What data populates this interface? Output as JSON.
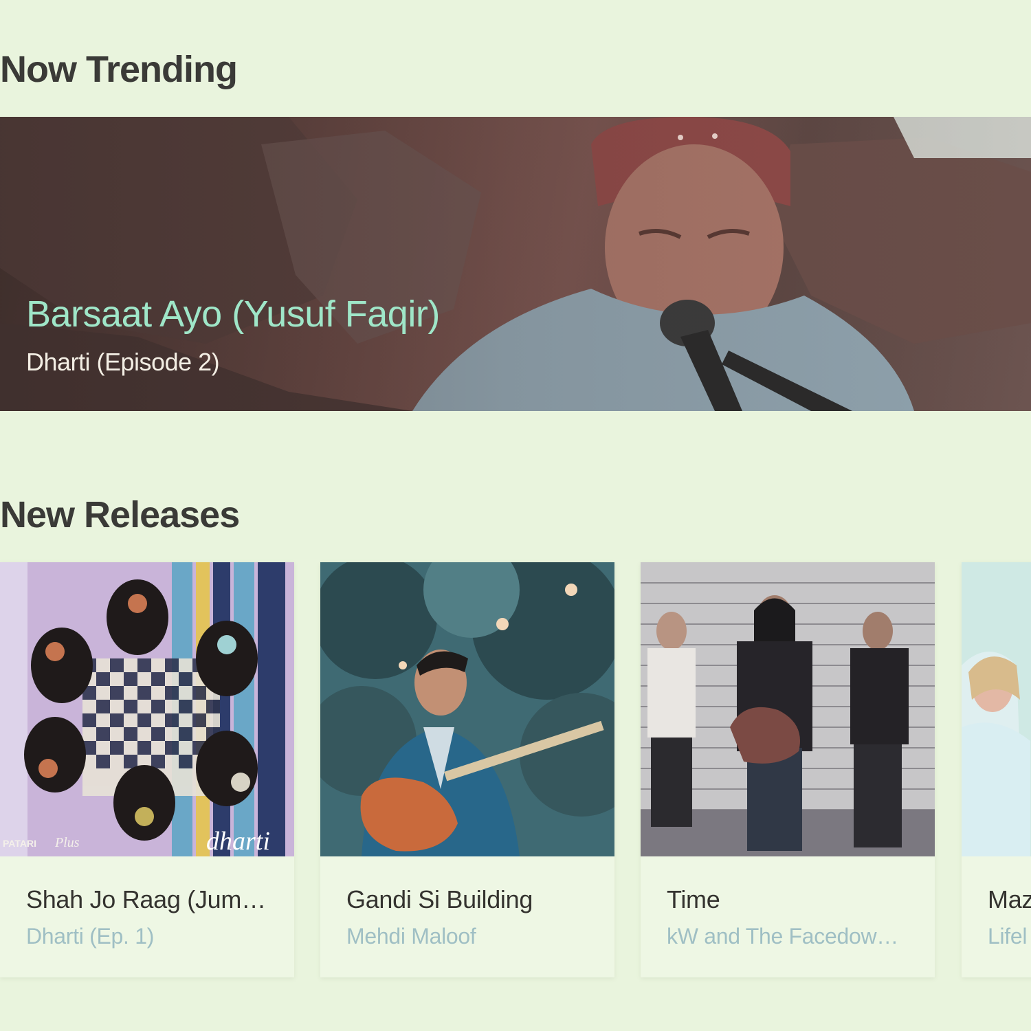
{
  "sections": {
    "trending_title": "Now Trending",
    "releases_title": "New Releases"
  },
  "hero": {
    "title": "Barsaat Ayo (Yusuf Faqir)",
    "subtitle": "Dharti (Episode 2)"
  },
  "releases": [
    {
      "title": "Shah Jo Raag (Jum…",
      "artist": "Dharti (Ep. 1)",
      "art_text_1": "PATARI",
      "art_text_2": "Plus",
      "art_text_3": "dharti"
    },
    {
      "title": "Gandi Si Building",
      "artist": "Mehdi Maloof"
    },
    {
      "title": "Time",
      "artist": "kW and The Facedow…"
    },
    {
      "title": "Maz",
      "artist": "Lifel"
    }
  ],
  "colors": {
    "background": "#e9f4dd",
    "hero_title": "#9fe6c8",
    "artist_text": "#9fbfc4",
    "heading": "#3a3a37"
  }
}
